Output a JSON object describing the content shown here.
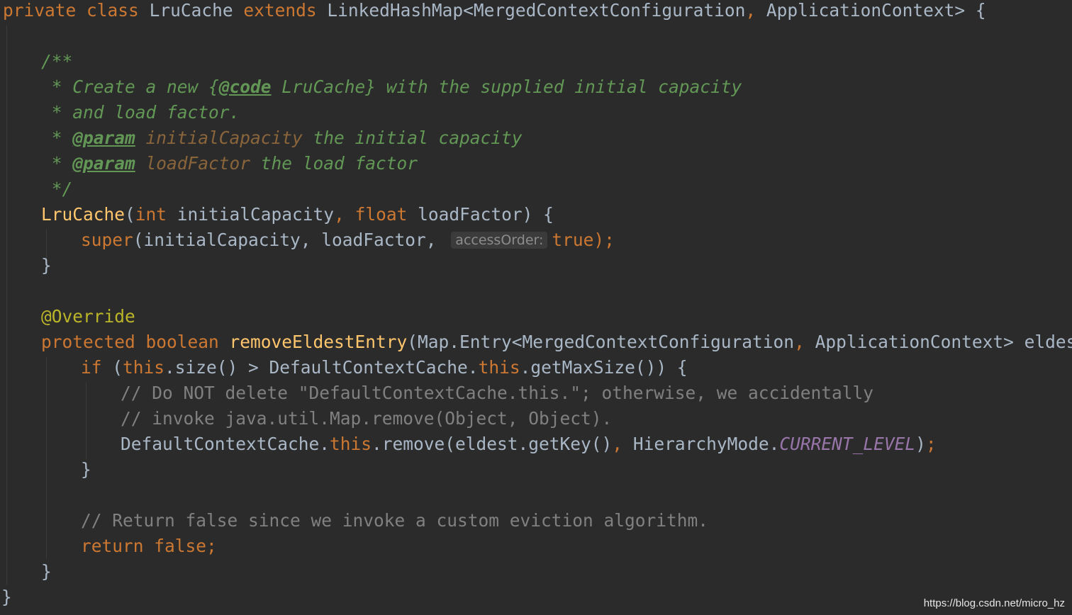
{
  "code": {
    "class_decl": {
      "private": "private",
      "class": "class",
      "name": "LruCache",
      "extends": "extends",
      "rest": " LinkedHashMap<MergedContextConfiguration",
      "comma": ",",
      "rest2": " ApplicationContext> {"
    },
    "doc": {
      "open": "/**",
      "l1_pre": " * Create a new {",
      "l1_tag": "@code",
      "l1_post": " LruCache} with the supplied initial capacity",
      "l2": " * and load factor.",
      "l3_pre": " * ",
      "l3_tag": "@param",
      "l3_param": " initialCapacity",
      "l3_post": " the initial capacity",
      "l4_pre": " * ",
      "l4_tag": "@param",
      "l4_param": " loadFactor",
      "l4_post": " the load factor",
      "close": " */"
    },
    "ctor": {
      "name": "LruCache",
      "open": "(",
      "int": "int",
      "p1": " initialCapacity",
      "comma": ",",
      "float": " float",
      "p2": " loadFactor) {"
    },
    "super_call": {
      "super": "super",
      "args": "(initialCapacity, loadFactor,",
      "hint": "accessOrder:",
      "true": "true",
      "end": ");"
    },
    "close_brace": "}",
    "override": "@Override",
    "method": {
      "protected": "protected",
      "boolean": " boolean",
      "name": " removeEldestEntry",
      "args": "(Map.Entry<MergedContextConfiguration",
      "comma": ",",
      "args2": " ApplicationContext> eldest) {"
    },
    "if_line": {
      "if": "if",
      "p1": " (",
      "this1": "this",
      "p2": ".size() > DefaultContextCache.",
      "this2": "this",
      "p3": ".getMaxSize()) {"
    },
    "comment1": "// Do NOT delete \"DefaultContextCache.this.\"; otherwise, we accidentally",
    "comment2": "// invoke java.util.Map.remove(Object, Object).",
    "remove_line": {
      "p1": "DefaultContextCache.",
      "this": "this",
      "p2": ".remove(eldest.getKey()",
      "comma": ",",
      "p3": " HierarchyMode.",
      "const": "CURRENT_LEVEL",
      "p4": ")",
      "semi": ";"
    },
    "comment3": "// Return false since we invoke a custom eviction algorithm.",
    "return_line": {
      "return": "return",
      "false": " false",
      "semi": ";"
    }
  },
  "watermark": "https://blog.csdn.net/micro_hz",
  "colors": {
    "background": "#2b2b2b",
    "keyword": "#cc7832",
    "function": "#ffc66d",
    "annotation": "#bbb529",
    "doc_comment": "#629755",
    "comment": "#808080",
    "constant": "#9876aa",
    "text": "#a9b7c6"
  }
}
